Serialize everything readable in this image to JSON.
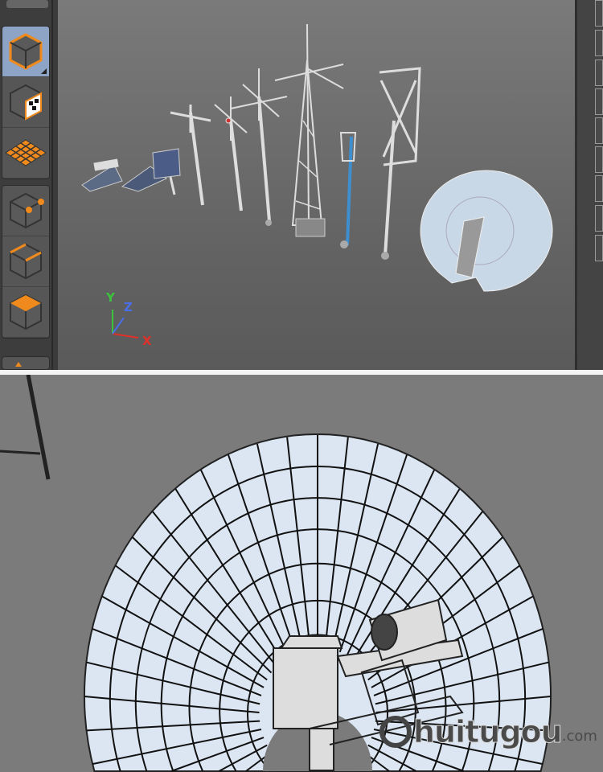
{
  "toolbar": {
    "tools": [
      {
        "name": "model-mode",
        "selected": true
      },
      {
        "name": "texture-mode",
        "selected": false
      },
      {
        "name": "workplane-mode",
        "selected": false
      },
      {
        "name": "points-mode",
        "selected": false
      },
      {
        "name": "edges-mode",
        "selected": false
      },
      {
        "name": "polygons-mode",
        "selected": false
      }
    ]
  },
  "viewport": {
    "axis": {
      "y": "Y",
      "z": "Z",
      "x": "X"
    }
  },
  "colors": {
    "accent": "#f08a1c",
    "selected": "#8ea4c6",
    "axis_x": "#e0302a",
    "axis_y": "#3cc23c",
    "axis_z": "#4a6ee8"
  },
  "watermark": {
    "brand": "huitugou",
    "domain": ".com"
  }
}
